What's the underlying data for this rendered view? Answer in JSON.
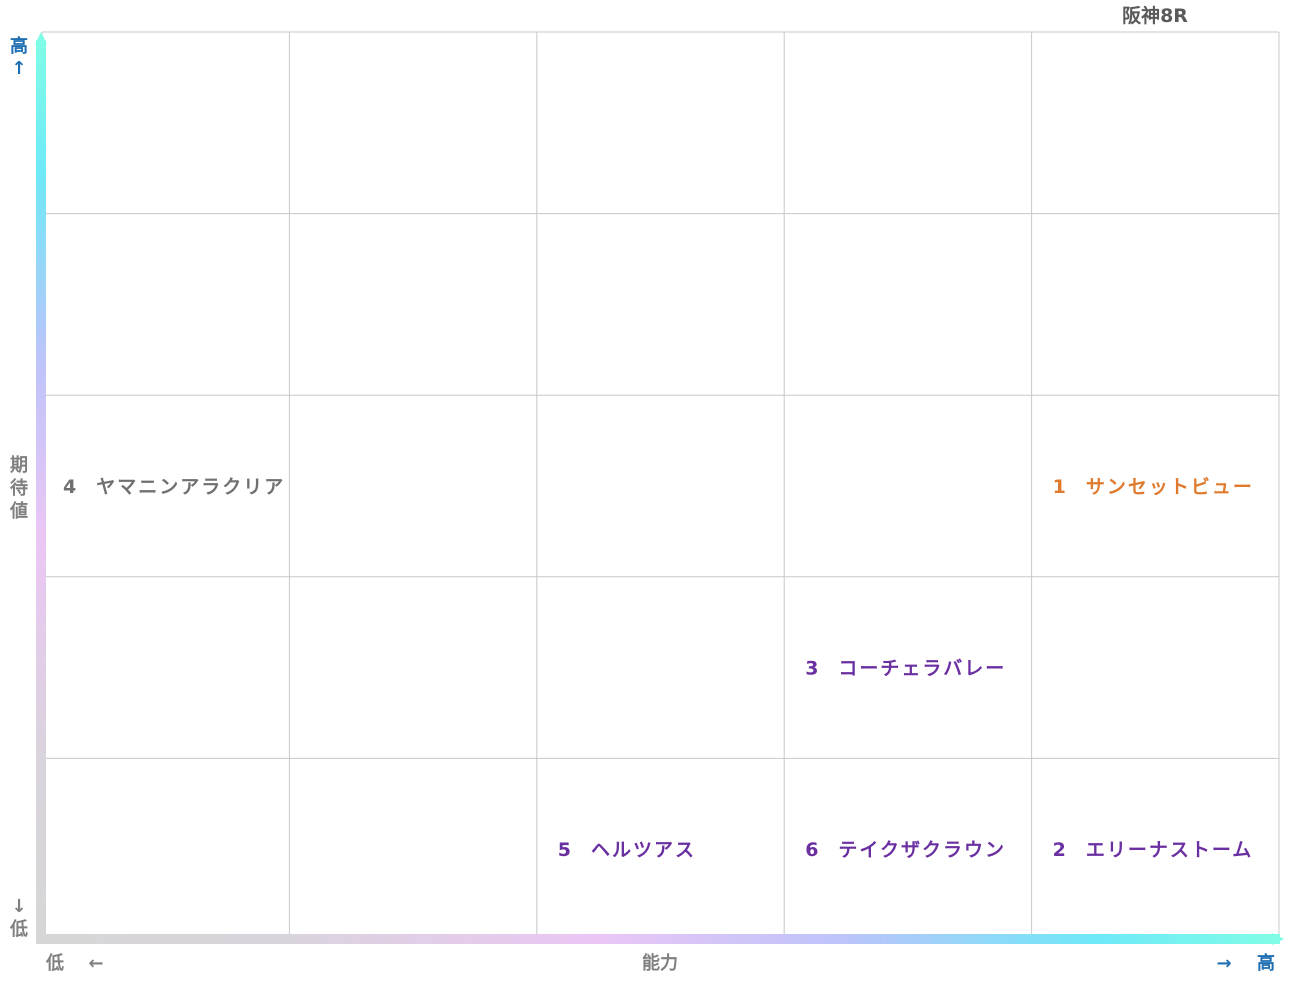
{
  "header": {
    "race": "阪神8R"
  },
  "axes": {
    "y_top": "高",
    "y_top_arrow": "↑",
    "y_title": [
      "期",
      "待",
      "値"
    ],
    "y_bottom_arrow": "↓",
    "y_bottom": "低",
    "x_left": "低",
    "x_left_arrow": "←",
    "x_title": "能力",
    "x_right_arrow": "→",
    "x_right": "高"
  },
  "colors": {
    "grid": "#c8c8c8",
    "axis_label_blue": "#1f6fb2",
    "axis_label_gray": "#808080",
    "horse_orange": "#e07a2e",
    "horse_gray": "#707070",
    "horse_purple": "#6a2fa0",
    "title_gray": "#5a5a5a"
  },
  "chart_data": {
    "type": "scatter",
    "grid": {
      "columns": 5,
      "rows": 5
    },
    "x_label": "能力",
    "y_label": "期待値",
    "points": [
      {
        "number": "1",
        "name": "サンセットビュー",
        "col": 5,
        "row": 3,
        "color": "orange"
      },
      {
        "number": "4",
        "name": "ヤマニンアラクリア",
        "col": 1,
        "row": 3,
        "color": "gray"
      },
      {
        "number": "3",
        "name": "コーチェラバレー",
        "col": 4,
        "row": 2,
        "color": "purple"
      },
      {
        "number": "5",
        "name": "ヘルツアス",
        "col": 3,
        "row": 1,
        "color": "purple"
      },
      {
        "number": "6",
        "name": "テイクザクラウン",
        "col": 4,
        "row": 1,
        "color": "purple"
      },
      {
        "number": "2",
        "name": "エリーナストーム",
        "col": 5,
        "row": 1,
        "color": "purple"
      }
    ]
  }
}
